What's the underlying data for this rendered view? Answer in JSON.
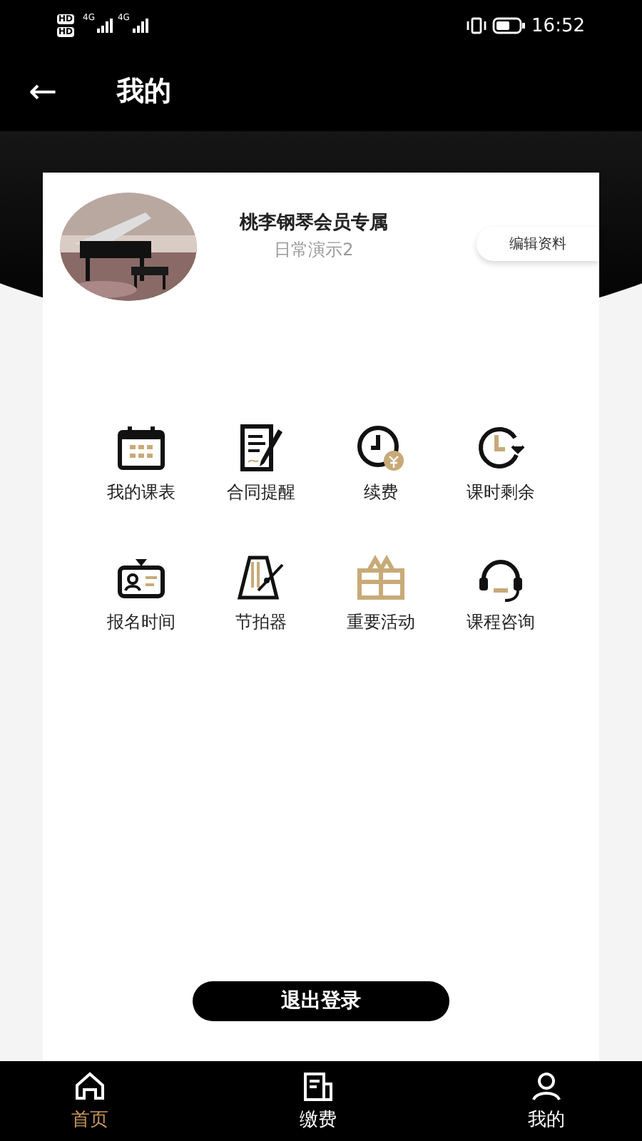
{
  "status_bar": {
    "time": "16:52",
    "sims": [
      {
        "hd": "HD",
        "network": "4G"
      },
      {
        "hd": "HD",
        "network": "4G"
      }
    ]
  },
  "header": {
    "back": "←",
    "title": "我的"
  },
  "profile": {
    "name": "桃李钢琴会员专属",
    "subtitle": "日常演示2",
    "edit_button": "编辑资料"
  },
  "grid": [
    {
      "kind": "calendar",
      "label": "我的课表"
    },
    {
      "kind": "contract",
      "label": "合同提醒"
    },
    {
      "kind": "renew",
      "label": "续费"
    },
    {
      "kind": "clock",
      "label": "课时剩余"
    },
    {
      "kind": "badge",
      "label": "报名时间"
    },
    {
      "kind": "metronome",
      "label": "节拍器"
    },
    {
      "kind": "gift",
      "label": "重要活动"
    },
    {
      "kind": "headset",
      "label": "课程咨询"
    }
  ],
  "logout_button": "退出登录",
  "tabs": [
    {
      "kind": "home",
      "label": "首页",
      "selected": true
    },
    {
      "kind": "bill",
      "label": "缴费",
      "selected": false
    },
    {
      "kind": "user",
      "label": "我的",
      "selected": false
    }
  ]
}
